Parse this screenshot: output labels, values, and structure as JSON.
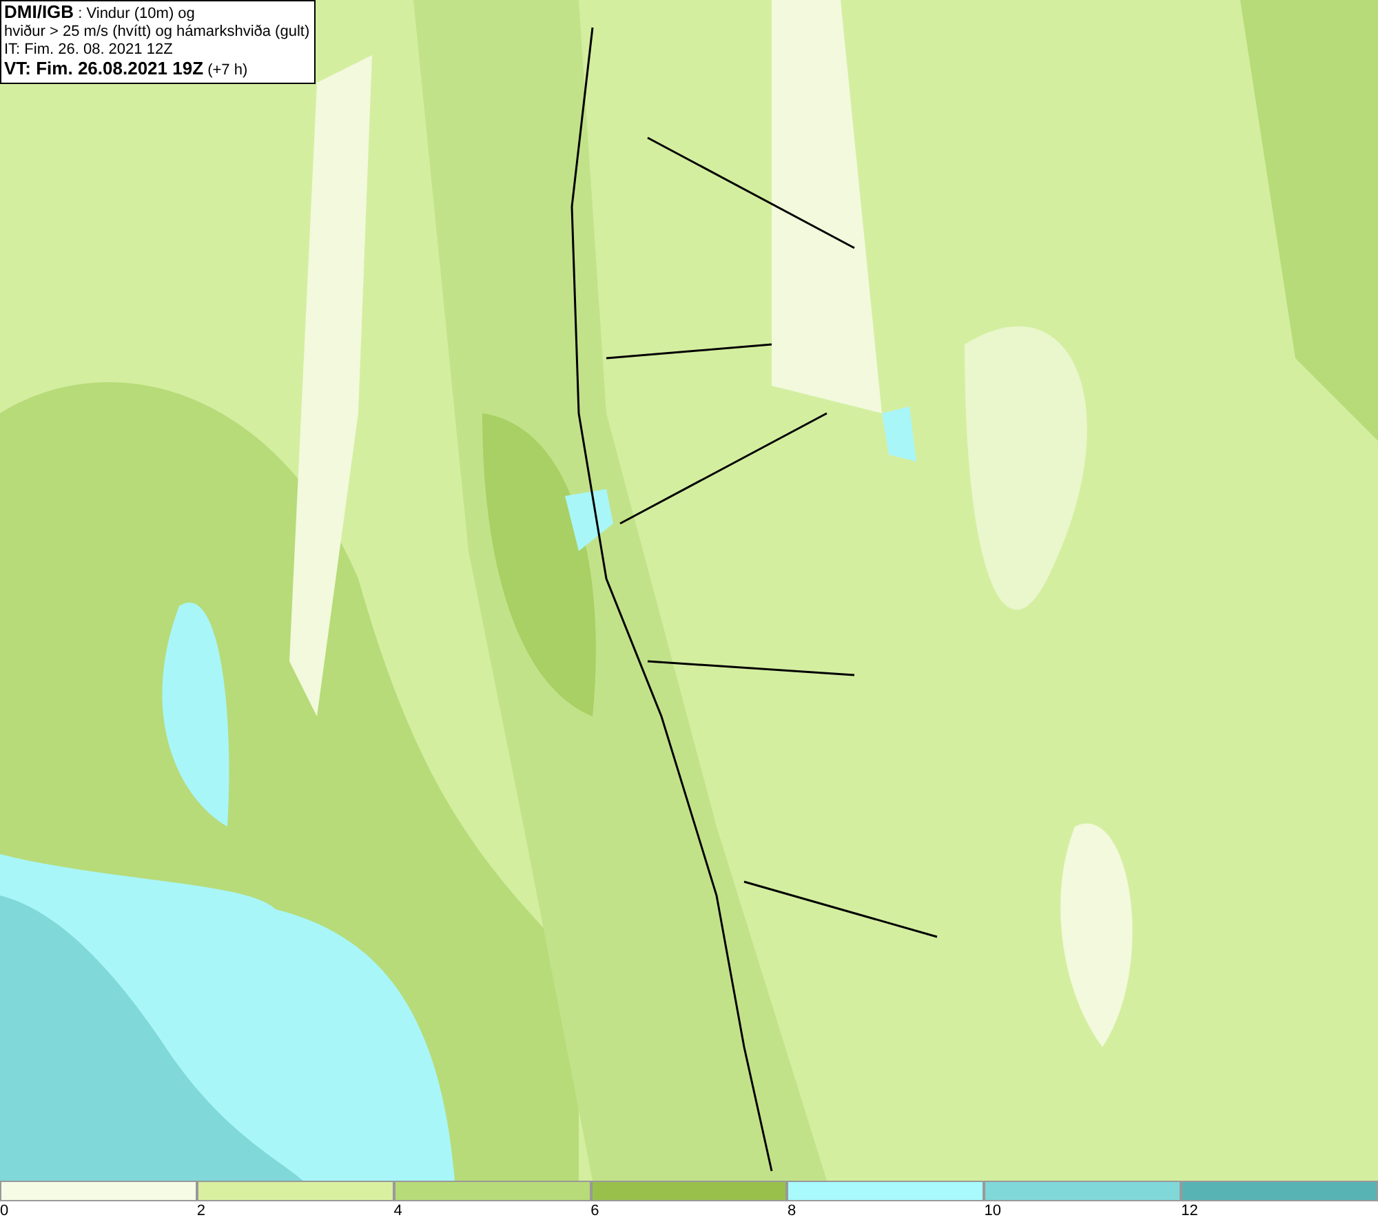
{
  "header": {
    "lines": [
      "**DMI/IGB** : Vindur (10m) og",
      "hviður > 25 m/s (hvítt) og hámarkshviða (gult)",
      "IT: Fim. 26. 08. 2021 12Z",
      "**VT: Fim. 26.08.2021 19Z** (+7 h)"
    ]
  },
  "legend": {
    "bins": [
      {
        "color": "#f6fbe6",
        "label": "0"
      },
      {
        "color": "#d8f0a0",
        "label": "2"
      },
      {
        "color": "#b7db78",
        "label": "4"
      },
      {
        "color": "#99c04a",
        "label": "6"
      },
      {
        "color": "#a8fafc",
        "label": "8"
      },
      {
        "color": "#80d8d8",
        "label": "10"
      },
      {
        "color": "#58b4b4",
        "label": "12"
      }
    ]
  }
}
